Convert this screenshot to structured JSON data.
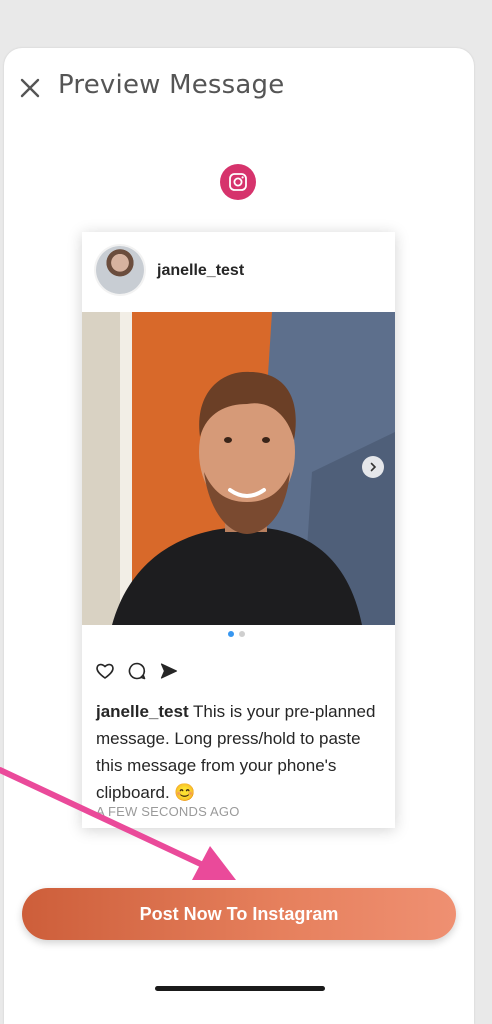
{
  "header": {
    "title": "Preview Message",
    "close_icon": "close-icon"
  },
  "platform_badge": {
    "icon": "instagram-icon",
    "color": "#d6336c"
  },
  "post_preview": {
    "username": "janelle_test",
    "carousel": {
      "total_slides": 2,
      "active_slide": 1
    },
    "caption_user": "janelle_test",
    "caption_text": "This is your pre-planned message. Long press/hold to paste this message from your phone's clipboard. 😊",
    "timestamp": "A FEW SECONDS AGO",
    "action_icons": [
      "heart-icon",
      "comment-icon",
      "share-icon"
    ]
  },
  "primary_action": {
    "label": "Post Now To Instagram",
    "color": "#e0774f"
  },
  "annotation": {
    "arrow_color": "#ea4a9a"
  }
}
